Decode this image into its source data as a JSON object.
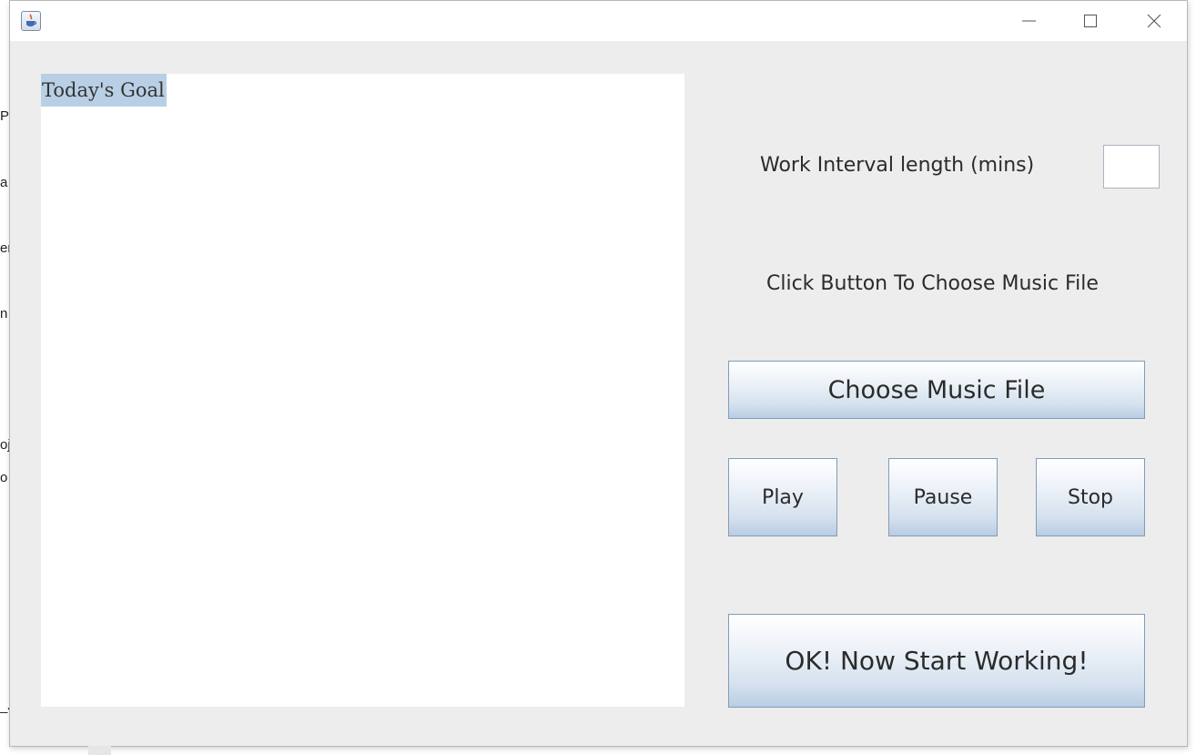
{
  "desktop": {
    "edge_fragments": [
      "Pr",
      "a",
      "er",
      "n",
      "oj",
      "o",
      "_J"
    ]
  },
  "window": {
    "titlebar": {
      "icon": "java-cup-icon",
      "controls": [
        "minimize-icon",
        "maximize-icon",
        "close-icon"
      ]
    }
  },
  "goal_panel": {
    "text": "Today's Goal"
  },
  "settings": {
    "interval_label": "Work Interval length (mins)",
    "interval_value": "",
    "music_label": "Click Button To Choose Music File"
  },
  "buttons": {
    "choose": "Choose Music File",
    "play": "Play",
    "pause": "Pause",
    "stop": "Stop",
    "start": "OK! Now Start Working!"
  },
  "colors": {
    "selection": "#b8cfe5",
    "button_border": "#7f9db9",
    "window_bg": "#ededed"
  }
}
